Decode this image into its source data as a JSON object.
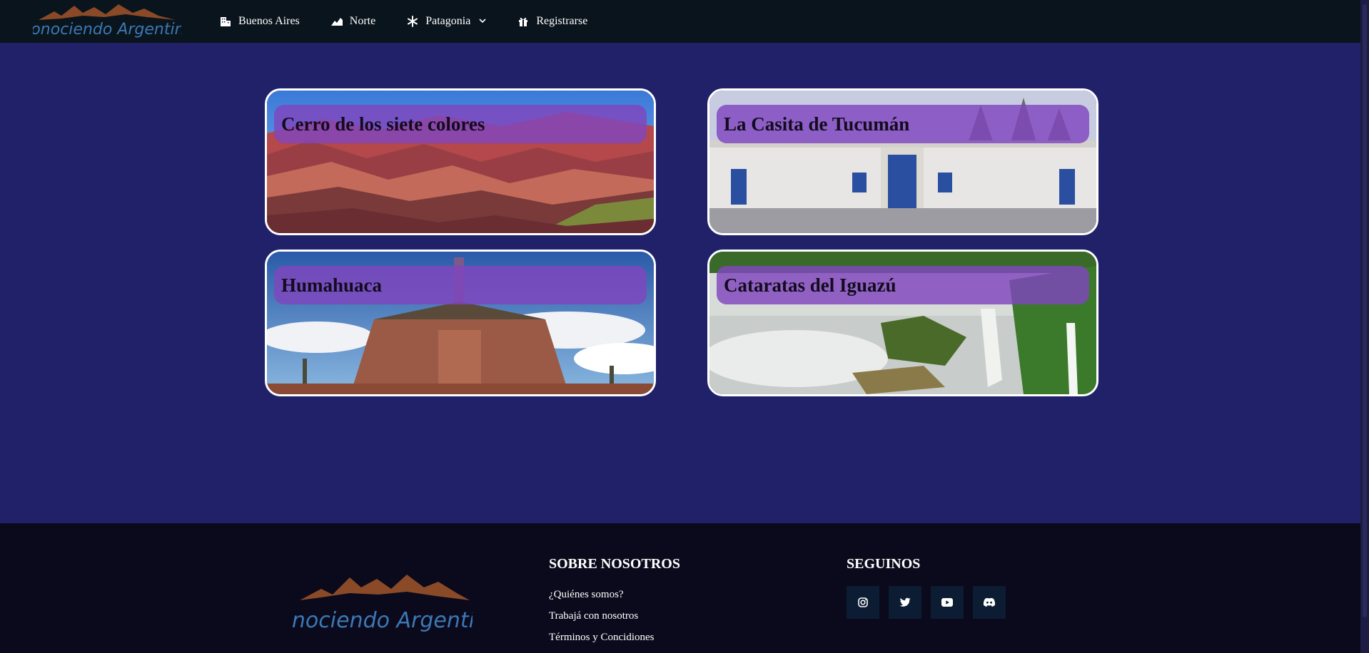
{
  "brand": {
    "name": "Conociendo Argentina"
  },
  "nav": {
    "items": [
      {
        "label": "Buenos Aires",
        "icon": "building-icon"
      },
      {
        "label": "Norte",
        "icon": "mountain-chart-icon"
      },
      {
        "label": "Patagonia",
        "icon": "snowflake-icon",
        "dropdown": true
      },
      {
        "label": "Registrarse",
        "icon": "gift-icon"
      }
    ]
  },
  "cards": [
    {
      "title": "Cerro de los siete colores"
    },
    {
      "title": "La Casita de Tucumán"
    },
    {
      "title": "Humahuaca"
    },
    {
      "title": "Cataratas del Iguazú"
    }
  ],
  "footer": {
    "brand_name": "Conociendo Argentina",
    "about": {
      "title": "SOBRE NOSOTROS",
      "links": [
        "¿Quiénes somos?",
        "Trabajá con nosotros",
        "Términos y Concidiones"
      ]
    },
    "follow": {
      "title": "SEGUINOS",
      "icons": [
        "instagram-icon",
        "twitter-icon",
        "youtube-icon",
        "discord-icon"
      ]
    }
  },
  "colors": {
    "background": "#21216a",
    "navbar": "#0a141c",
    "footer": "#0a0a1c",
    "card_title_overlay": "#8046be",
    "social_button": "#0c1c32",
    "logo_mountains": "#8a4a28",
    "logo_text": "#3c78b4"
  }
}
